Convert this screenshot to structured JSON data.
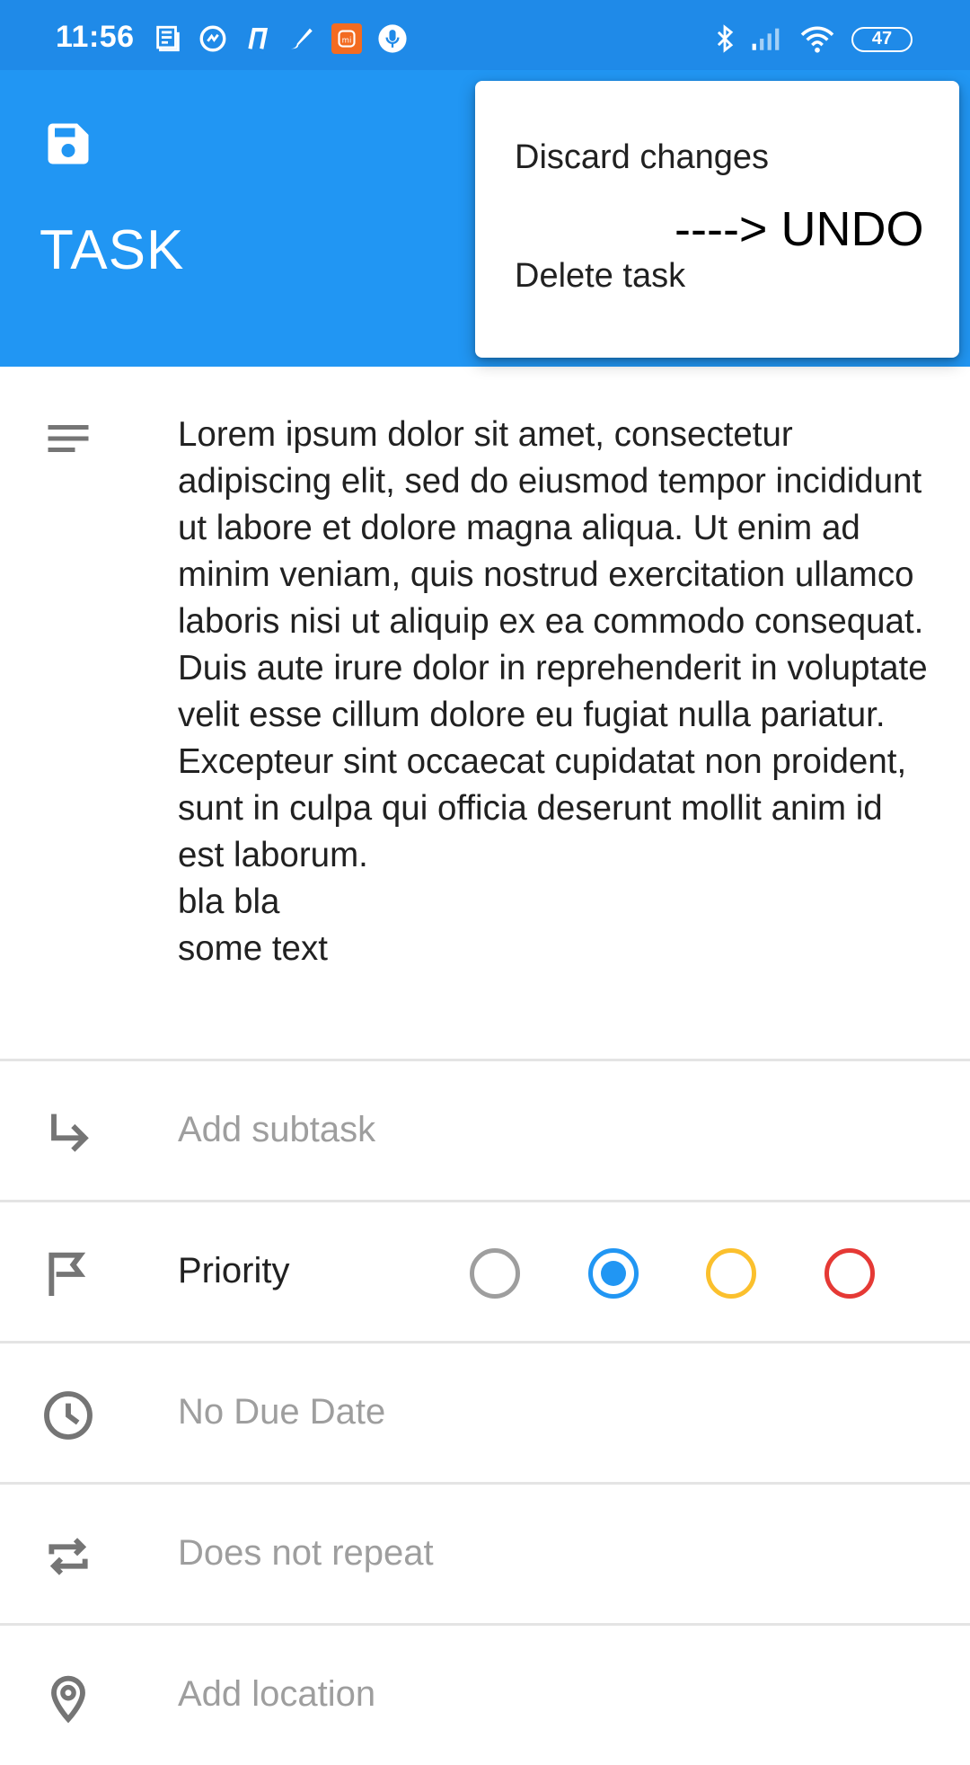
{
  "status_bar": {
    "time": "11:56",
    "battery": "47",
    "icons": [
      "news-icon",
      "sync-icon",
      "notification-icon",
      "brush-icon",
      "mi-app-icon",
      "microphone-icon",
      "bluetooth-icon",
      "signal-icon",
      "wifi-icon",
      "battery-icon"
    ],
    "mi_badge_color": "#f36b21"
  },
  "app_bar": {
    "title": "TASK",
    "save_icon": "save-icon",
    "color": "#2196f3"
  },
  "menu": {
    "discard_label": "Discard changes",
    "annotation": "----> UNDO",
    "delete_label": "Delete task"
  },
  "description": {
    "icon": "notes-icon",
    "text": "Lorem ipsum dolor sit amet, consectetur adipiscing elit, sed do eiusmod tempor incididunt ut labore et dolore magna aliqua. Ut enim ad minim veniam, quis nostrud exercitation ullamco laboris nisi ut aliquip ex ea commodo consequat. Duis aute irure dolor in reprehenderit in voluptate velit esse cillum dolore eu fugiat nulla pariatur. Excepteur sint occaecat cupidatat non proident, sunt in culpa qui officia deserunt mollit anim id est laborum.\nbla bla\nsome text"
  },
  "subtask": {
    "icon": "subtask-arrow-icon",
    "placeholder": "Add subtask"
  },
  "priority": {
    "icon": "flag-icon",
    "label": "Priority",
    "options": [
      {
        "color": "#9e9e9e",
        "selected": false
      },
      {
        "color": "#2196f3",
        "selected": true
      },
      {
        "color": "#fbc02d",
        "selected": false
      },
      {
        "color": "#e53935",
        "selected": false
      }
    ]
  },
  "due_date": {
    "icon": "clock-icon",
    "label": "No Due Date"
  },
  "repeat": {
    "icon": "repeat-icon",
    "label": "Does not repeat"
  },
  "location": {
    "icon": "location-pin-icon",
    "placeholder": "Add location"
  }
}
